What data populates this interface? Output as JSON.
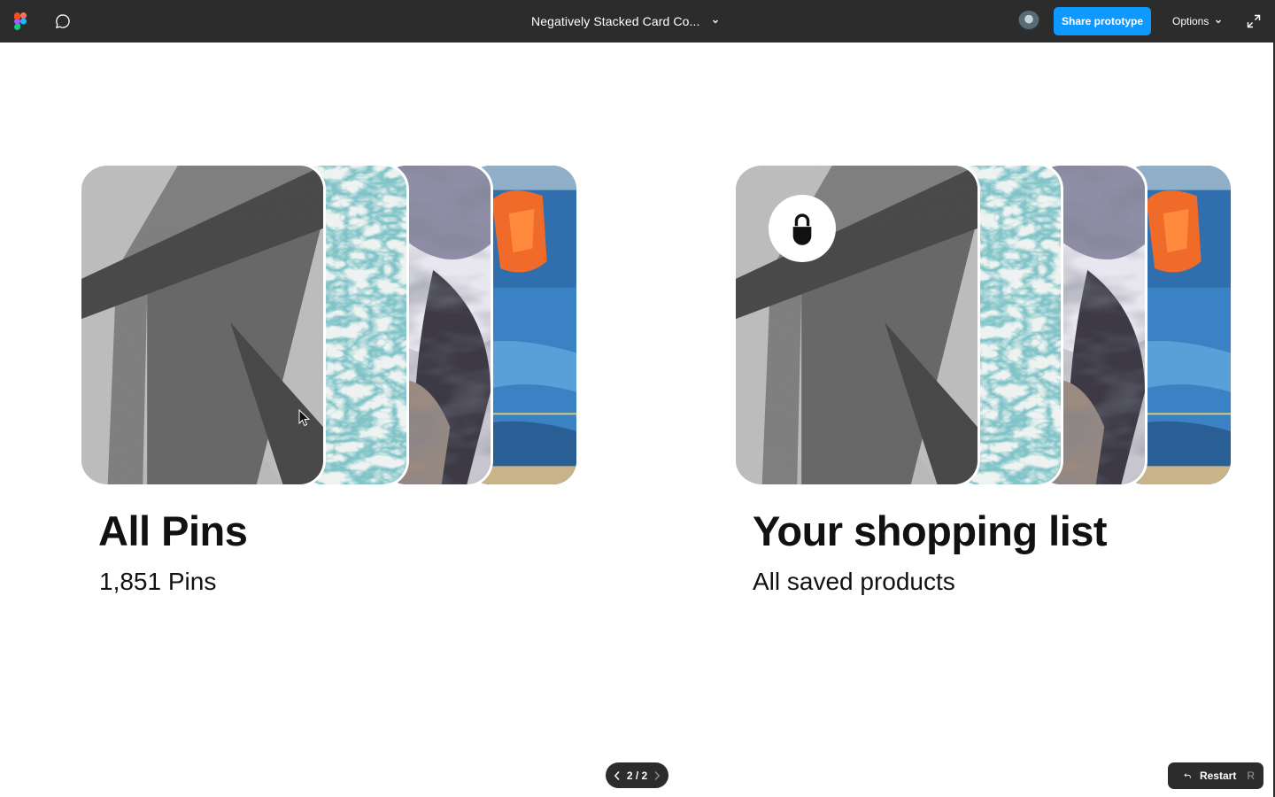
{
  "topbar": {
    "logo_icon": "figma-logo-icon",
    "comment_icon": "comment-bubble-icon",
    "file_title": "Negatively Stacked Card Co...",
    "title_menu_icon": "chevron-down-icon",
    "avatar_icon": "user-avatar",
    "share_label": "Share prototype",
    "options_label": "Options",
    "expand_icon": "expand-icon",
    "accent_color": "#0d99ff",
    "bar_color": "#2c2c2c"
  },
  "boards": [
    {
      "title": "All Pins",
      "subtitle": "1,851 Pins",
      "locked": false,
      "card_images": [
        "abstract-gray-shapes",
        "ocean-foam",
        "marbled-clay",
        "blue-orange-paint"
      ]
    },
    {
      "title": "Your shopping list",
      "subtitle": "All saved products",
      "locked": true,
      "lock_icon": "lock-icon",
      "card_images": [
        "abstract-gray-shapes",
        "ocean-foam",
        "marbled-clay",
        "blue-orange-paint"
      ]
    }
  ],
  "pager": {
    "label": "2 / 2",
    "prev_icon": "chevron-left-icon",
    "next_icon": "chevron-right-icon"
  },
  "restart": {
    "icon": "return-arrow-icon",
    "label": "Restart",
    "shortcut": "R"
  }
}
